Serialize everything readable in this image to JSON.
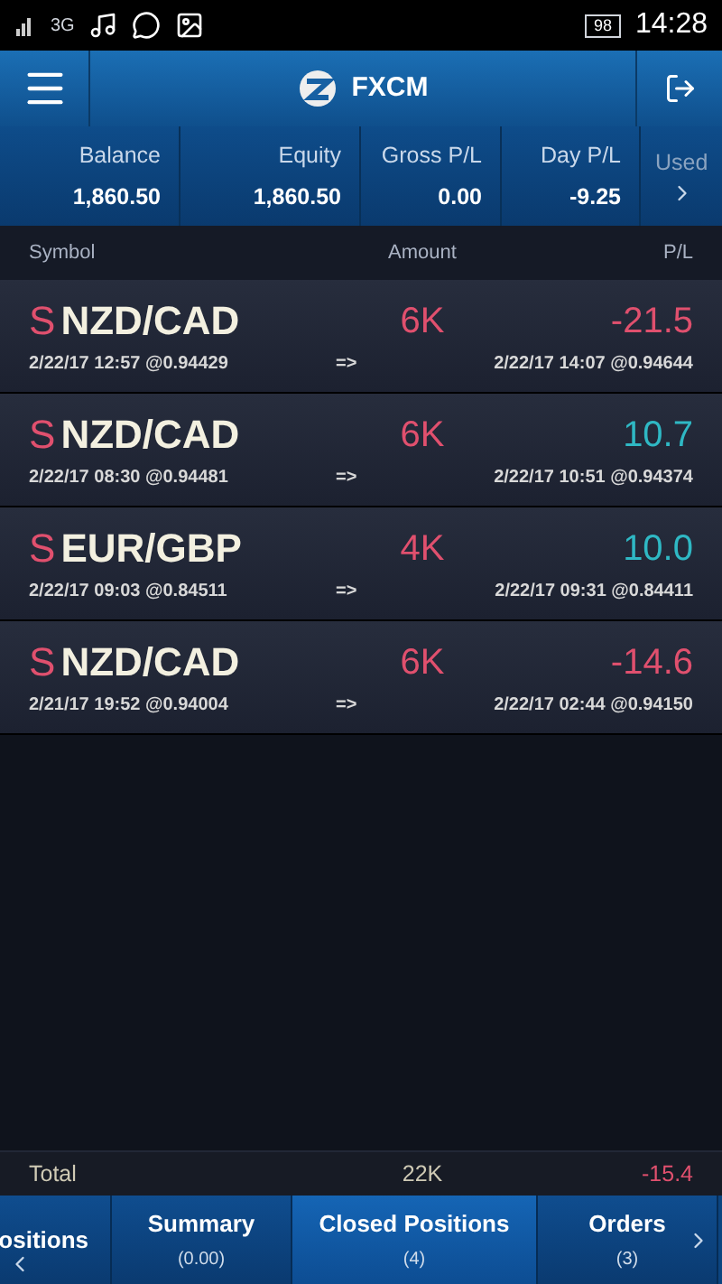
{
  "status_bar": {
    "network": "3G",
    "battery": "98",
    "time": "14:28"
  },
  "header": {
    "title": "FXCM"
  },
  "summary": [
    {
      "label": "Balance",
      "value": "1,860.50"
    },
    {
      "label": "Equity",
      "value": "1,860.50"
    },
    {
      "label": "Gross P/L",
      "value": "0.00"
    },
    {
      "label": "Day P/L",
      "value": "-9.25"
    },
    {
      "label": "Used"
    }
  ],
  "table": {
    "columns": [
      "Symbol",
      "Amount",
      "P/L"
    ],
    "rows": [
      {
        "side": "S",
        "symbol": "NZD/CAD",
        "amount": "6K",
        "pl": "-21.5",
        "color": "#e0506e",
        "open": "2/22/17 12:57 @0.94429",
        "arrow": "=>",
        "close": "2/22/17 14:07 @0.94644"
      },
      {
        "side": "S",
        "symbol": "NZD/CAD",
        "amount": "6K",
        "pl": "10.7",
        "color": "#2fb8c4",
        "open": "2/22/17 08:30 @0.94481",
        "arrow": "=>",
        "close": "2/22/17 10:51 @0.94374"
      },
      {
        "side": "S",
        "symbol": "EUR/GBP",
        "amount": "4K",
        "pl": "10.0",
        "color": "#2fb8c4",
        "open": "2/22/17 09:03 @0.84511",
        "arrow": "=>",
        "close": "2/22/17 09:31 @0.84411"
      },
      {
        "side": "S",
        "symbol": "NZD/CAD",
        "amount": "6K",
        "pl": "-14.6",
        "color": "#e0506e",
        "open": "2/21/17 19:52 @0.94004",
        "arrow": "=>",
        "close": "2/22/17 02:44 @0.94150"
      }
    ],
    "total": {
      "label": "Total",
      "amount": "22K",
      "pl": "-15.4"
    }
  },
  "tabs": [
    {
      "label": "ositions",
      "selected": false
    },
    {
      "label": "Summary",
      "count": "(0.00)",
      "selected": false
    },
    {
      "label": "Closed Positions",
      "count": "(4)",
      "selected": true
    },
    {
      "label": "Orders",
      "count": "(3)",
      "selected": false
    }
  ]
}
